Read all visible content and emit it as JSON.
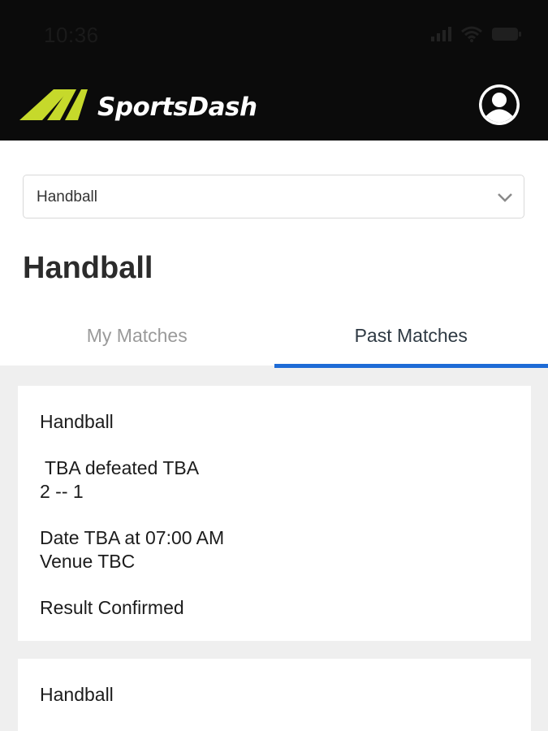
{
  "status_bar": {
    "time": "10:36",
    "icons": [
      "signal-icon",
      "wifi-icon",
      "battery-icon"
    ]
  },
  "header": {
    "app_name": "SportsDash",
    "logo_color": "#c6d92b",
    "profile_icon": "user-circle-icon"
  },
  "sport_select": {
    "value": "Handball",
    "icon": "chevron-down-icon"
  },
  "page": {
    "title": "Handball"
  },
  "tabs": [
    {
      "label": "My Matches",
      "active": false
    },
    {
      "label": "Past Matches",
      "active": true
    }
  ],
  "colors": {
    "accent": "#1e6bd6",
    "header_bg": "#0b0b0b",
    "list_bg": "#efefef"
  },
  "matches": [
    {
      "sport": "Handball",
      "result_line": " TBA defeated TBA",
      "score": "2 -- 1",
      "date_line": "Date TBA at 07:00 AM",
      "venue_line": "Venue TBC",
      "status": "Result Confirmed"
    },
    {
      "sport": "Handball"
    }
  ]
}
